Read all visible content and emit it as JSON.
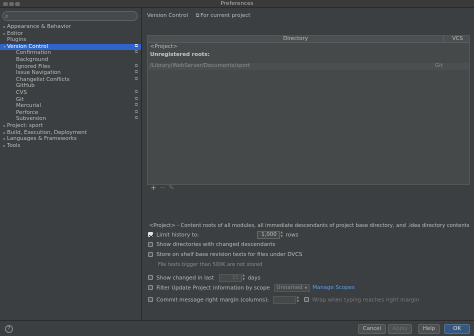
{
  "window": {
    "title": "Preferences"
  },
  "sidebar": {
    "search_value": "",
    "items": [
      {
        "label": "Appearance & Behavior",
        "level": 0,
        "arrow": "▸",
        "project": false,
        "selected": false
      },
      {
        "label": "Editor",
        "level": 0,
        "arrow": "▸",
        "project": false,
        "selected": false
      },
      {
        "label": "Plugins",
        "level": 0,
        "arrow": "",
        "project": false,
        "selected": false
      },
      {
        "label": "Version Control",
        "level": 0,
        "arrow": "▾",
        "project": true,
        "selected": true
      },
      {
        "label": "Confirmation",
        "level": 1,
        "arrow": "",
        "project": true,
        "selected": false
      },
      {
        "label": "Background",
        "level": 1,
        "arrow": "",
        "project": false,
        "selected": false
      },
      {
        "label": "Ignored Files",
        "level": 1,
        "arrow": "",
        "project": true,
        "selected": false
      },
      {
        "label": "Issue Navigation",
        "level": 1,
        "arrow": "",
        "project": true,
        "selected": false
      },
      {
        "label": "Changelist Conflicts",
        "level": 1,
        "arrow": "",
        "project": true,
        "selected": false
      },
      {
        "label": "GitHub",
        "level": 1,
        "arrow": "",
        "project": false,
        "selected": false
      },
      {
        "label": "CVS",
        "level": 1,
        "arrow": "",
        "project": true,
        "selected": false
      },
      {
        "label": "Git",
        "level": 1,
        "arrow": "",
        "project": true,
        "selected": false
      },
      {
        "label": "Mercurial",
        "level": 1,
        "arrow": "",
        "project": true,
        "selected": false
      },
      {
        "label": "Perforce",
        "level": 1,
        "arrow": "",
        "project": true,
        "selected": false
      },
      {
        "label": "Subversion",
        "level": 1,
        "arrow": "",
        "project": true,
        "selected": false
      },
      {
        "label": "Project: sport",
        "level": 0,
        "arrow": "▸",
        "project": false,
        "selected": false
      },
      {
        "label": "Build, Execution, Deployment",
        "level": 0,
        "arrow": "▸",
        "project": false,
        "selected": false
      },
      {
        "label": "Languages & Frameworks",
        "level": 0,
        "arrow": "▸",
        "project": false,
        "selected": false
      },
      {
        "label": "Tools",
        "level": 0,
        "arrow": "▸",
        "project": false,
        "selected": false
      }
    ]
  },
  "header": {
    "breadcrumb": "Version Control",
    "scope": "For current project"
  },
  "table": {
    "col_directory": "Directory",
    "col_vcs": "VCS",
    "project_row": "<Project>",
    "unregistered_label": "Unregistered roots:",
    "root_path": "/Library/WebServer/Documents/sport",
    "root_vcs": "Git"
  },
  "toolbar": {
    "add": "+",
    "remove": "−",
    "edit": "✎"
  },
  "description": "<Project> - Content roots of all modules, all immediate descendants of project base directory, and .idea directory contents",
  "settings": {
    "limit_history_label": "Limit history to:",
    "limit_history_value": "1,000",
    "limit_history_unit": "rows",
    "show_dirs_label": "Show directories with changed descendants",
    "store_shelf_label": "Store on shelf base revision texts for files under DVCS",
    "store_shelf_hint": "File texts bigger than 500K are not stored",
    "show_changed_label": "Show changed in last",
    "show_changed_value": "31",
    "show_changed_unit": "days",
    "filter_label": "Filter Update Project information by scope",
    "filter_scope": "Unnamed",
    "manage_scopes": "Manage Scopes",
    "commit_label": "Commit message right margin (columns):",
    "commit_value": "",
    "wrap_label": "Wrap when typing reaches right margin"
  },
  "footer": {
    "cancel": "Cancel",
    "apply": "Apply",
    "help": "Help",
    "ok": "OK"
  },
  "colors": {
    "accent": "#2f65ca",
    "link": "#589df6",
    "primary_button": "#365880",
    "background": "#3c3f41"
  }
}
